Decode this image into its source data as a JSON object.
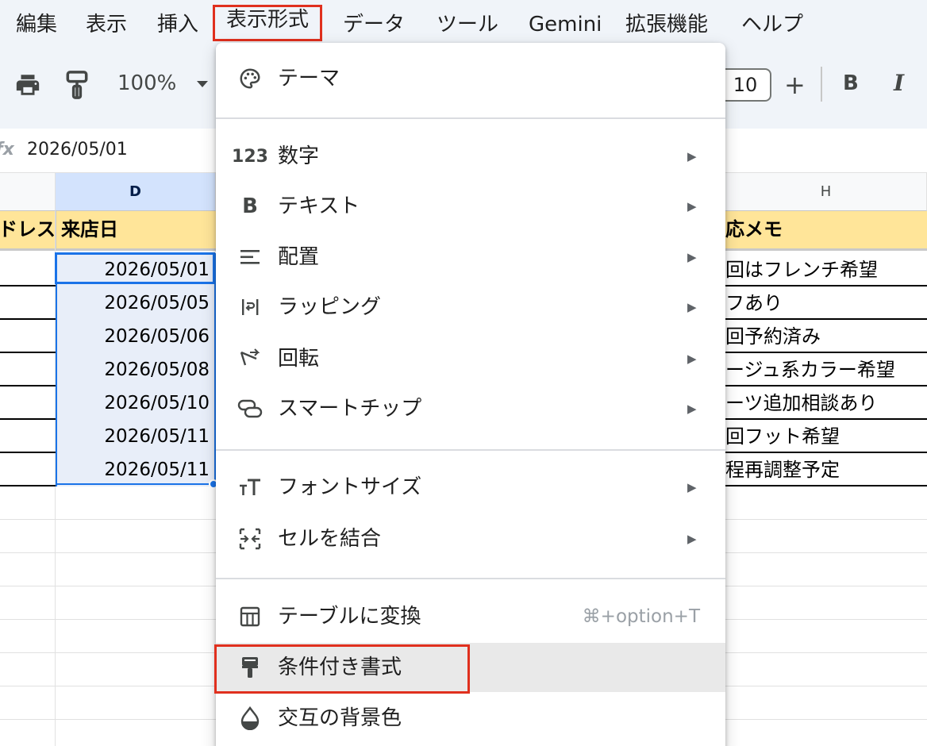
{
  "menubar": {
    "items": [
      "編集",
      "表示",
      "挿入",
      "表示形式",
      "データ",
      "ツール",
      "Gemini",
      "拡張機能",
      "ヘルプ"
    ],
    "active": "表示形式"
  },
  "toolbar": {
    "zoom": "100%",
    "font_size": "10",
    "bold_label": "B",
    "italic_label": "I",
    "plus_label": "+"
  },
  "formula": {
    "fx_label": "fx",
    "value": "2026/05/01"
  },
  "sheet": {
    "col_d": "D",
    "col_h": "H",
    "header_left": "ドレス",
    "header_d": "来店日",
    "header_h": "応メモ",
    "dates": [
      "2026/05/01",
      "2026/05/05",
      "2026/05/06",
      "2026/05/08",
      "2026/05/10",
      "2026/05/11",
      "2026/05/11"
    ],
    "memos": [
      "回はフレンチ希望",
      "フあり",
      "回予約済み",
      "ージュ系カラー希望",
      "ーツ追加相談あり",
      "回フット希望",
      "程再調整予定"
    ]
  },
  "format_menu": {
    "theme": "テーマ",
    "number": "数字",
    "text": "テキスト",
    "align": "配置",
    "wrap": "ラッピング",
    "rotate": "回転",
    "smart_chips": "スマートチップ",
    "font_size": "フォントサイズ",
    "merge": "セルを結合",
    "convert_table": "テーブルに変換",
    "convert_table_shortcut": "⌘+option+T",
    "conditional": "条件付き書式",
    "alternating": "交互の背景色",
    "number_icon_text": "123",
    "text_icon_text": "B",
    "arrow": "▶"
  },
  "colors": {
    "highlight": "#e0301e",
    "selection": "#1a73e8",
    "header_fill": "#ffe599",
    "hover": "#e9e9e9"
  }
}
